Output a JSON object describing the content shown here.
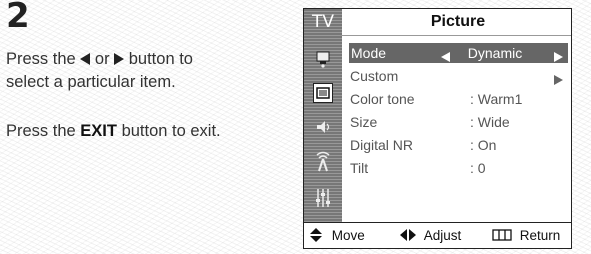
{
  "step": {
    "number": "2"
  },
  "instructions": {
    "line1_a": "Press the",
    "line1_or": "or",
    "line1_b": "button to",
    "line2": "select a particular item.",
    "line3_a": "Press the",
    "line3_bold": "EXIT",
    "line3_b": "button to exit."
  },
  "osd": {
    "tab_label": "TV",
    "title": "Picture",
    "items": [
      {
        "label": "Mode",
        "value": "Dynamic",
        "highlighted": true
      },
      {
        "label": "Custom",
        "value": ""
      },
      {
        "label": "Color tone",
        "value": ": Warm1"
      },
      {
        "label": "Size",
        "value": ": Wide"
      },
      {
        "label": "Digital NR",
        "value": ": On"
      },
      {
        "label": "Tilt",
        "value": ": 0"
      }
    ],
    "icons": [
      "input-icon",
      "picture-icon",
      "sound-icon",
      "channel-icon",
      "setup-icon"
    ],
    "footer": {
      "move": "Move",
      "adjust": "Adjust",
      "return": "Return"
    }
  }
}
